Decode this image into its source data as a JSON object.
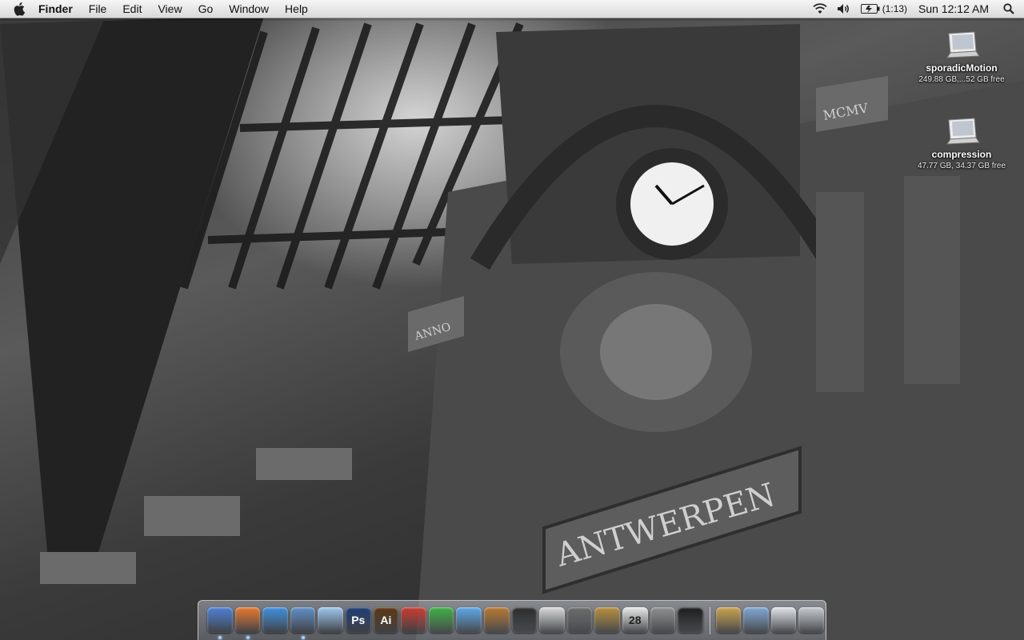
{
  "menubar": {
    "apple_icon": "apple-icon",
    "app_name": "Finder",
    "menus": [
      "File",
      "Edit",
      "View",
      "Go",
      "Window",
      "Help"
    ],
    "status": {
      "wifi_icon": "wifi-icon",
      "volume_icon": "volume-icon",
      "battery_icon": "battery-icon",
      "battery_text": "(1:13)",
      "clock": "Sun 12:12 AM",
      "spotlight_icon": "spotlight-search-icon"
    }
  },
  "desktop": {
    "icons": [
      {
        "name": "sporadicMotion",
        "info": "249.88 GB,...52 GB free",
        "icon": "external-drive-icon"
      },
      {
        "name": "compression",
        "info": "47.77 GB, 34.37 GB free",
        "icon": "external-drive-icon"
      }
    ],
    "wallpaper_text": [
      "ANTWERPEN",
      "ANNO",
      "MCMV"
    ]
  },
  "dock": {
    "apps": [
      {
        "name": "Finder",
        "icon": "finder-icon",
        "running": true,
        "color": "#4a7fd6"
      },
      {
        "name": "Firefox",
        "icon": "firefox-icon",
        "running": true,
        "color": "#e8772e"
      },
      {
        "name": "Safari",
        "icon": "safari-icon",
        "running": false,
        "color": "#3d8fe0"
      },
      {
        "name": "Mail",
        "icon": "mail-icon",
        "running": true,
        "color": "#5f8fc7"
      },
      {
        "name": "iChat",
        "icon": "ichat-icon",
        "running": false,
        "color": "#9cc8ee"
      },
      {
        "name": "Photoshop",
        "icon": "photoshop-icon",
        "running": false,
        "color": "#1c3b74",
        "label": "Ps"
      },
      {
        "name": "Illustrator",
        "icon": "illustrator-icon",
        "running": false,
        "color": "#5a3510",
        "label": "Ai"
      },
      {
        "name": "Zoom utility",
        "icon": "zoom-icon",
        "running": false,
        "color": "#c83a2e"
      },
      {
        "name": "Leaf app",
        "icon": "leaf-icon",
        "running": false,
        "color": "#3bb043"
      },
      {
        "name": "iTunes",
        "icon": "itunes-icon",
        "running": false,
        "color": "#5aa7e8"
      },
      {
        "name": "GarageBand",
        "icon": "garageband-icon",
        "running": false,
        "color": "#b8782f"
      },
      {
        "name": "iMovie",
        "icon": "imovie-star-icon",
        "running": false,
        "color": "#2b2b2b"
      },
      {
        "name": "Adium",
        "icon": "adium-duck-icon",
        "running": false,
        "color": "#d8d8d8"
      },
      {
        "name": "iPhoto",
        "icon": "iphoto-icon",
        "running": false,
        "color": "#6a6a6a"
      },
      {
        "name": "Address Book",
        "icon": "address-book-icon",
        "running": false,
        "color": "#b58e3a"
      },
      {
        "name": "iCal",
        "icon": "ical-icon",
        "running": false,
        "color": "#e9e9e9",
        "label": "28"
      },
      {
        "name": "System Preferences",
        "icon": "system-preferences-icon",
        "running": false,
        "color": "#8f8f8f"
      },
      {
        "name": "Terminal",
        "icon": "terminal-icon",
        "running": false,
        "color": "#1a1a1a"
      }
    ],
    "stacks": [
      {
        "name": "Contacts stack",
        "icon": "contacts-stack-icon",
        "color": "#c9a24d"
      },
      {
        "name": "Folder",
        "icon": "folder-icon",
        "color": "#7fa7d6"
      },
      {
        "name": "Documents",
        "icon": "documents-icon",
        "color": "#dfe4ea"
      },
      {
        "name": "Trash",
        "icon": "trash-icon",
        "color": "#c5c9cf"
      }
    ]
  }
}
